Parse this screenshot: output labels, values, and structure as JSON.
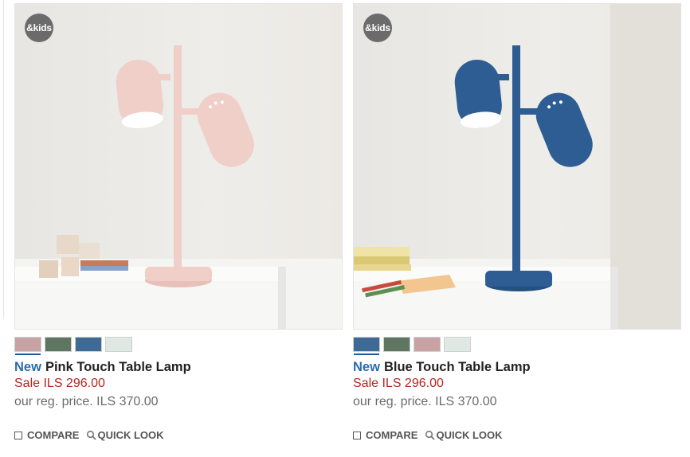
{
  "products": [
    {
      "badge": "&kids",
      "new_label": "New",
      "name": "Pink Touch Table Lamp",
      "sale_price": "Sale ILS 296.00",
      "reg_price": "our reg. price. ILS 370.00",
      "compare_label": "COMPARE",
      "quick_look_label": "QUICK LOOK",
      "lamp_color": "#f0cfc9",
      "swatches": [
        "#c9a2a3",
        "#5e7560",
        "#3d6b96",
        "#dfe8e2"
      ]
    },
    {
      "badge": "&kids",
      "new_label": "New",
      "name": "Blue Touch Table Lamp",
      "sale_price": "Sale ILS 296.00",
      "reg_price": "our reg. price. ILS 370.00",
      "compare_label": "COMPARE",
      "quick_look_label": "QUICK LOOK",
      "lamp_color": "#2e5d93",
      "swatches": [
        "#3d6b96",
        "#5e7560",
        "#c9a2a3",
        "#dfe8e2"
      ]
    }
  ],
  "colors": {
    "new_label": "#2b6cb0",
    "sale": "#b3261e",
    "selected_swatch_underline": "#1f5d9c"
  }
}
